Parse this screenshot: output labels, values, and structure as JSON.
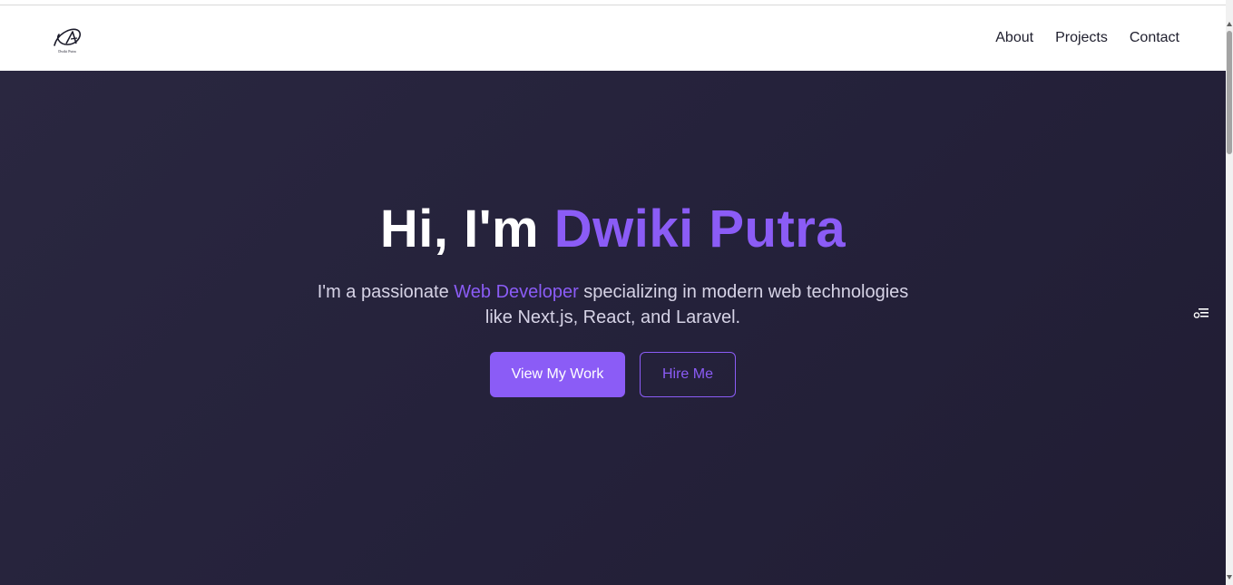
{
  "navbar": {
    "logo": {
      "icon": "dwiki-putra-logo-icon",
      "text": "Dwiki Putra"
    },
    "links": [
      "About",
      "Projects",
      "Contact"
    ]
  },
  "hero": {
    "title_prefix": "Hi, I'm ",
    "title_name": "Dwiki Putra",
    "subtitle_before": "I'm a passionate ",
    "subtitle_highlight": "Web Developer",
    "subtitle_after": " specializing in modern web technologies like Next.js, React, and Laravel.",
    "primary_button": "View My Work",
    "secondary_button": "Hire Me"
  },
  "side_widget": {
    "icon": "accessibility-settings-icon"
  },
  "colors": {
    "accent": "#8b5cf6",
    "hero_background": "#27243b",
    "nav_text": "#1f1f2e",
    "navbar_background": "#ffffff"
  }
}
